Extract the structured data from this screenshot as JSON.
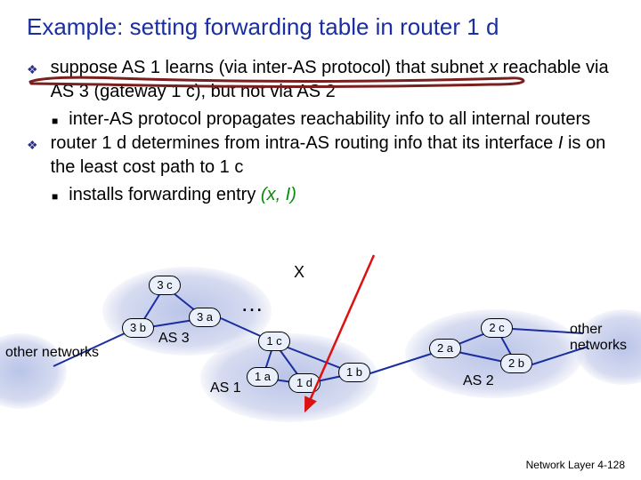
{
  "title": "Example: setting forwarding table in router 1 d",
  "bullets": [
    {
      "text_parts": [
        "suppose AS 1 learns (via inter-AS protocol) that subnet ",
        "x",
        " reachable via AS 3 (gateway 1 c), but not via AS 2"
      ],
      "sub": [
        "inter-AS protocol propagates reachability info to all internal routers"
      ]
    },
    {
      "text_parts": [
        "router 1 d determines from intra-AS routing info that its interface ",
        "I",
        "  is on the least cost path to 1 c"
      ],
      "sub_parts": [
        "installs forwarding         entry ",
        "(x, I)"
      ]
    }
  ],
  "routers": {
    "r3c": "3 c",
    "r3b": "3 b",
    "r3a": "3 a",
    "r1a": "1 a",
    "r1b": "1 b",
    "r1c": "1 c",
    "r1d": "1 d",
    "r2a": "2 a",
    "r2b": "2 b",
    "r2c": "2 c"
  },
  "as_labels": {
    "as1": "AS 1",
    "as2": "AS 2",
    "as3": "AS 3"
  },
  "side_labels": {
    "left": "other networks",
    "right": "other networks"
  },
  "x_label": "X",
  "dots": "…",
  "footer": "Network Layer  4-128"
}
